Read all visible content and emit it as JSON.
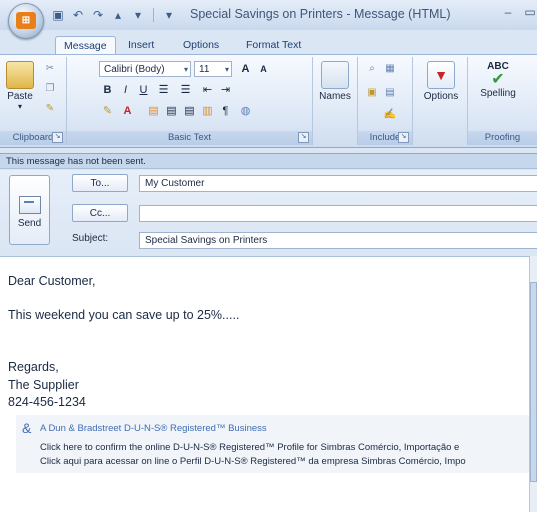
{
  "window": {
    "title": "Special Savings on Printers - Message (HTML)",
    "minimize": "–",
    "maximize": "▭"
  },
  "tabs": [
    "Message",
    "Insert",
    "Options",
    "Format Text"
  ],
  "ribbon": {
    "clipboard": {
      "paste": "Paste",
      "label": "Clipboard"
    },
    "basic_text": {
      "font": "Calibri (Body)",
      "size": "11",
      "label": "Basic Text"
    },
    "names": {
      "button": "Names"
    },
    "include": {
      "label": "Include"
    },
    "options": {
      "button": "Options"
    },
    "proofing": {
      "spelling": "Spelling",
      "abc": "ABC",
      "label": "Proofing"
    }
  },
  "infobar": {
    "text": "This message has not been sent."
  },
  "header": {
    "send": "Send",
    "to_label": "To...",
    "cc_label": "Cc...",
    "subject_label": "Subject:",
    "to_value": "My Customer",
    "cc_value": "",
    "subject_value": "Special Savings on Printers"
  },
  "body": {
    "greeting": "Dear Customer,",
    "line1": "This weekend you can save up to 25%.....",
    "regards": "Regards,",
    "sender": "The Supplier",
    "phone": "824-456-1234"
  },
  "signature": {
    "title": "A Dun & Bradstreet D-U-N-S® Registered™ Business",
    "line1": "Click here to confirm the online D-U-N-S® Registered™ Profile for Simbras Comércio, Importação e",
    "line2": "Click aqui para acessar on line o Perfil D-U-N-S® Registered™ da empresa Simbras Comércio, Impo"
  }
}
